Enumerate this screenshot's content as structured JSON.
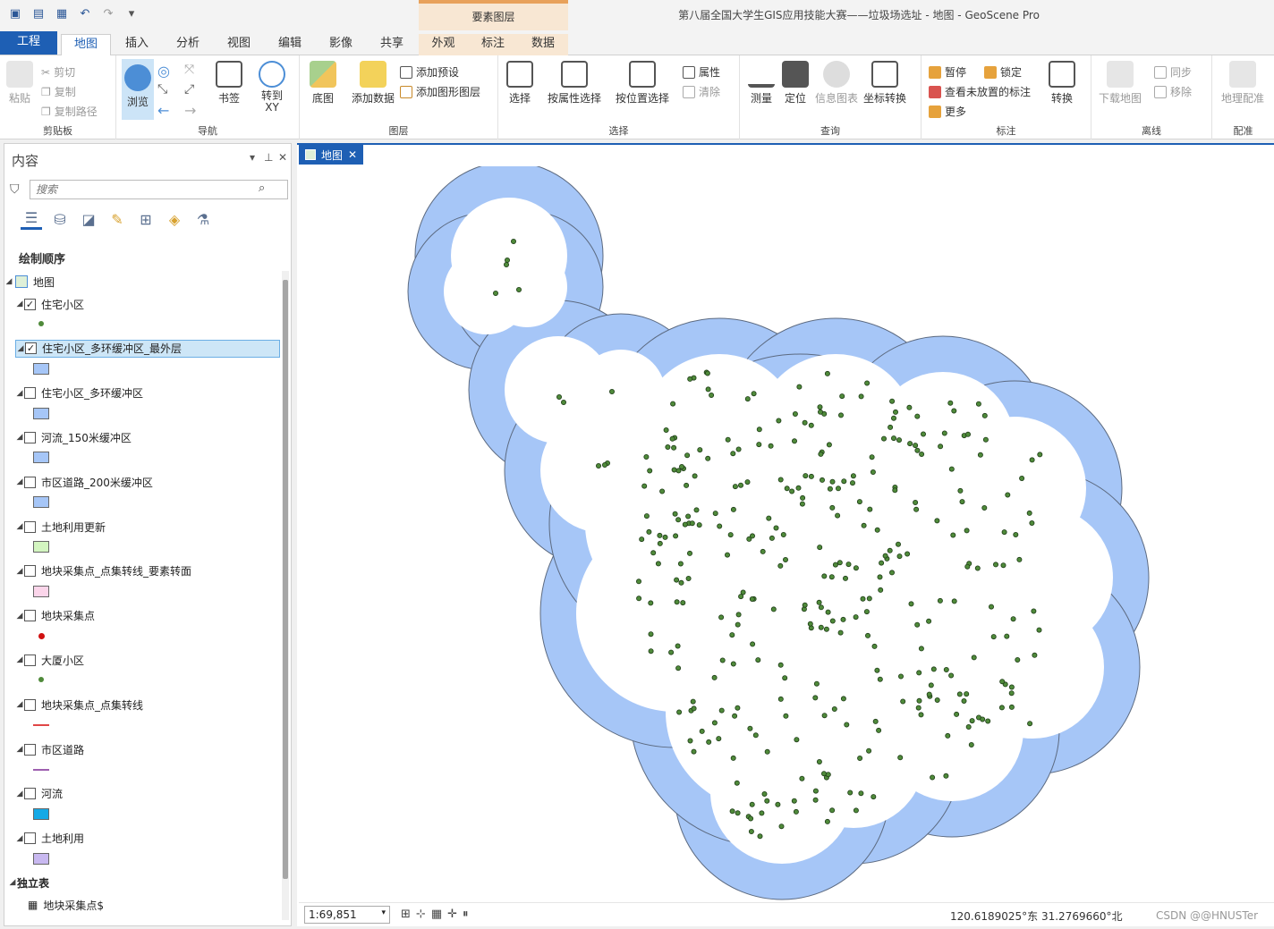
{
  "window_title": "第八届全国大学生GIS应用技能大赛——垃圾场选址 - 地图 - GeoScene Pro",
  "context_header": "要素图层",
  "tabs": [
    "工程",
    "地图",
    "插入",
    "分析",
    "视图",
    "编辑",
    "影像",
    "共享",
    "外观",
    "标注",
    "数据"
  ],
  "ribbon": {
    "clipboard": {
      "label": "剪贴板",
      "paste": "粘贴",
      "cut": "剪切",
      "copy": "复制",
      "copy_path": "复制路径"
    },
    "navigate": {
      "label": "导航",
      "explore": "浏览",
      "bookmarks": "书签",
      "goto": "转到\nXY"
    },
    "layer": {
      "label": "图层",
      "basemap": "底图",
      "add_data": "添加数据",
      "add_preset": "添加预设",
      "add_graphics": "添加图形图层"
    },
    "selection": {
      "label": "选择",
      "select": "选择",
      "by_attr": "按属性选择",
      "by_loc": "按位置选择",
      "attributes": "属性",
      "clear": "清除"
    },
    "inquiry": {
      "label": "查询",
      "measure": "测量",
      "locate": "定位",
      "infographics": "信息图表",
      "coord_convert": "坐标转换"
    },
    "labeling": {
      "label": "标注",
      "pause": "暂停",
      "lock": "锁定",
      "view_unplaced": "查看未放置的标注",
      "more": "更多",
      "convert": "转换"
    },
    "offline": {
      "label": "离线",
      "download": "下载地图",
      "sync": "同步",
      "remove": "移除"
    },
    "georef": {
      "label": "配准",
      "button": "地理配准"
    }
  },
  "contents": {
    "title": "内容",
    "search_placeholder": "搜索",
    "drawing_order": "绘制顺序",
    "map_node": "地图",
    "layers": [
      {
        "name": "住宅小区",
        "checked": true,
        "symbol": "point-green"
      },
      {
        "name": "住宅小区_多环缓冲区_最外层",
        "checked": true,
        "symbol": "fill-blue",
        "selected": true
      },
      {
        "name": "住宅小区_多环缓冲区",
        "checked": false,
        "symbol": "fill-blue"
      },
      {
        "name": "河流_150米缓冲区",
        "checked": false,
        "symbol": "fill-blue"
      },
      {
        "name": "市区道路_200米缓冲区",
        "checked": false,
        "symbol": "fill-blue"
      },
      {
        "name": "土地利用更新",
        "checked": false,
        "symbol": "fill-lightgreen"
      },
      {
        "name": "地块采集点_点集转线_要素转面",
        "checked": false,
        "symbol": "fill-pink"
      },
      {
        "name": "地块采集点",
        "checked": false,
        "symbol": "point-red"
      },
      {
        "name": "大厦小区",
        "checked": false,
        "symbol": "point-green"
      },
      {
        "name": "地块采集点_点集转线",
        "checked": false,
        "symbol": "line-red"
      },
      {
        "name": "市区道路",
        "checked": false,
        "symbol": "line-purple"
      },
      {
        "name": "河流",
        "checked": false,
        "symbol": "fill-cyan"
      },
      {
        "name": "土地利用",
        "checked": false,
        "symbol": "fill-lavender"
      }
    ],
    "standalone_tables": "独立表",
    "table_item": "地块采集点$"
  },
  "map_tab": "地图",
  "status": {
    "scale": "1:69,851",
    "coords": "120.6189025°东 31.2769660°北",
    "watermark": "CSDN @@HNUSTer"
  },
  "colors": {
    "accent": "#1e5fb4",
    "buffer_fill": "#a6c6f7",
    "point_fill": "#4f8a3a"
  }
}
